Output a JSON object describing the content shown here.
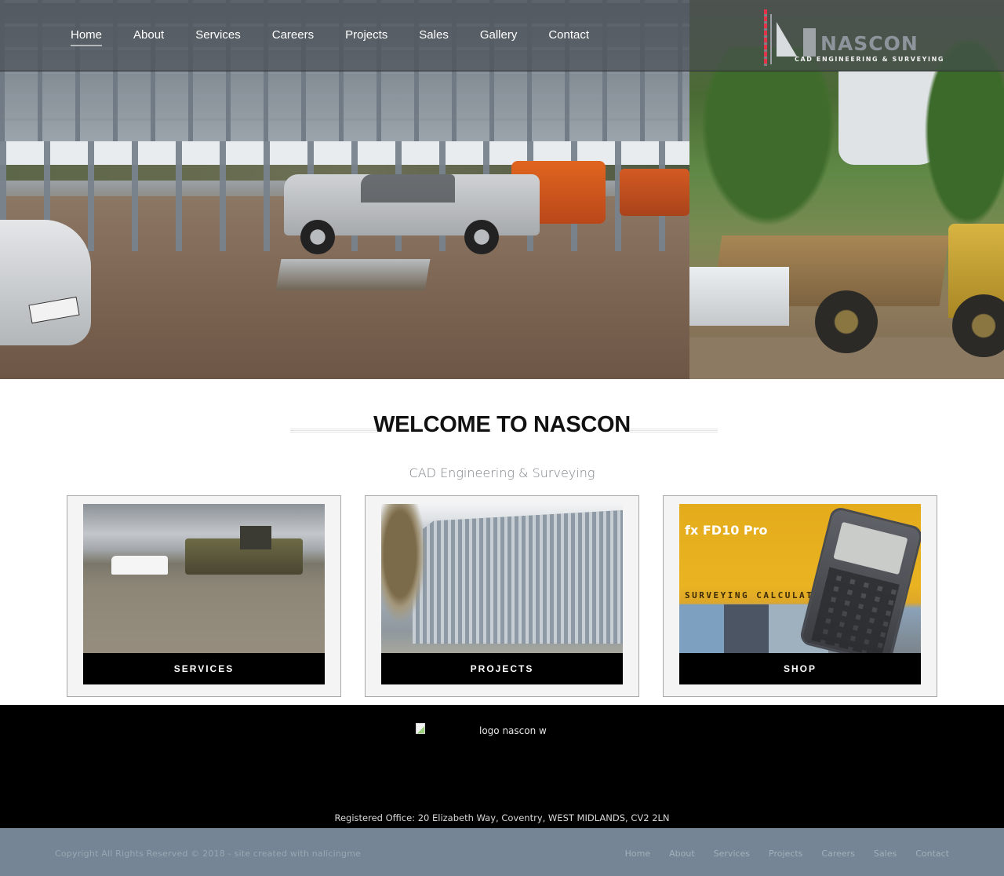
{
  "header": {
    "nav": [
      {
        "label": "Home",
        "active": true
      },
      {
        "label": "About"
      },
      {
        "label": "Services"
      },
      {
        "label": "Careers"
      },
      {
        "label": "Projects"
      },
      {
        "label": "Sales"
      },
      {
        "label": "Gallery"
      },
      {
        "label": "Contact"
      }
    ],
    "logo": {
      "wordmark": "NASCON",
      "tagline": "CAD ENGINEERING & SURVEYING"
    }
  },
  "hero": {
    "images": [
      "construction-site-steel-frame",
      "dump-truck-site"
    ]
  },
  "welcome": {
    "title": "WELCOME TO NASCON",
    "subtitle": "CAD Engineering & Surveying"
  },
  "cards": [
    {
      "label": "SERVICES",
      "image": "site-vehicles-photo"
    },
    {
      "label": "PROJECTS",
      "image": "office-building-photo"
    },
    {
      "label": "SHOP",
      "image": "surveying-calculator-photo",
      "image_text": {
        "title": "fx FD10 Pro",
        "caption": "SURVEYING CALCULATOR"
      }
    }
  ],
  "footer": {
    "logo_alt": "logo nascon w",
    "address": "Registered Office: 20 Elizabeth Way, Coventry, WEST MIDLANDS, CV2 2LN",
    "copyright": "Copyright All Rights Reserved © 2018 - site created with nalicingme",
    "nav": [
      "Home",
      "About",
      "Services",
      "Projects",
      "Careers",
      "Sales",
      "Contact"
    ]
  }
}
